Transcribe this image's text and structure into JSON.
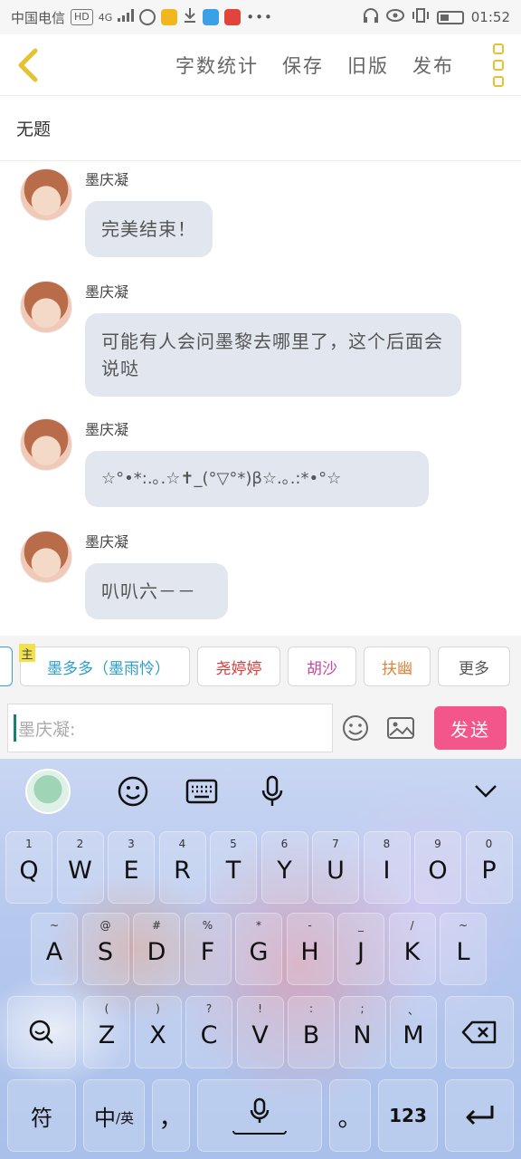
{
  "status_bar": {
    "carrier": "中国电信",
    "network": "HD",
    "signal": "4G",
    "time": "01:52"
  },
  "header": {
    "actions": [
      "字数统计",
      "保存",
      "旧版",
      "发布"
    ],
    "accent": "#e6c232"
  },
  "title": "无题",
  "messages": [
    {
      "name": "墨庆凝",
      "text": "完美结束！"
    },
    {
      "name": "墨庆凝",
      "text": "可能有人会问墨黎去哪里了，这个后面会说哒"
    },
    {
      "name": "墨庆凝",
      "text": "☆°•*:.｡.☆✝_(°▽°*)β☆.｡.:*•°☆"
    },
    {
      "name": "墨庆凝",
      "text": "叭叭六－－"
    }
  ],
  "chips": {
    "tag": "主",
    "items": [
      "墨多多（墨雨怜）",
      "尧婷婷",
      "胡沙",
      "扶幽"
    ],
    "more": "更多",
    "colors": [
      "#2f9ec5",
      "#d83a3a",
      "#c24a98",
      "#e0823a",
      "#555555"
    ]
  },
  "input": {
    "placeholder": "墨庆凝:",
    "send_label": "发送",
    "send_color": "#f2568a"
  },
  "keyboard": {
    "row1": [
      {
        "hint": "1",
        "key": "Q"
      },
      {
        "hint": "2",
        "key": "W"
      },
      {
        "hint": "3",
        "key": "E"
      },
      {
        "hint": "4",
        "key": "R"
      },
      {
        "hint": "5",
        "key": "T"
      },
      {
        "hint": "6",
        "key": "Y"
      },
      {
        "hint": "7",
        "key": "U"
      },
      {
        "hint": "8",
        "key": "I"
      },
      {
        "hint": "9",
        "key": "O"
      },
      {
        "hint": "0",
        "key": "P"
      }
    ],
    "row2": [
      {
        "hint": "~",
        "key": "A"
      },
      {
        "hint": "@",
        "key": "S"
      },
      {
        "hint": "#",
        "key": "D"
      },
      {
        "hint": "%",
        "key": "F"
      },
      {
        "hint": "*",
        "key": "G"
      },
      {
        "hint": "-",
        "key": "H"
      },
      {
        "hint": "_",
        "key": "J"
      },
      {
        "hint": "/",
        "key": "K"
      },
      {
        "hint": "~",
        "key": "L"
      }
    ],
    "row3": [
      {
        "hint": "(",
        "key": "Z"
      },
      {
        "hint": ")",
        "key": "X"
      },
      {
        "hint": "?",
        "key": "C"
      },
      {
        "hint": "!",
        "key": "V"
      },
      {
        "hint": ":",
        "key": "B"
      },
      {
        "hint": ";",
        "key": "N"
      },
      {
        "hint": "、",
        "key": "M"
      }
    ],
    "symbol_key": "符",
    "lang_main": "中",
    "lang_sub": "/英",
    "comma": "，",
    "period": "。",
    "num_key": "123"
  }
}
